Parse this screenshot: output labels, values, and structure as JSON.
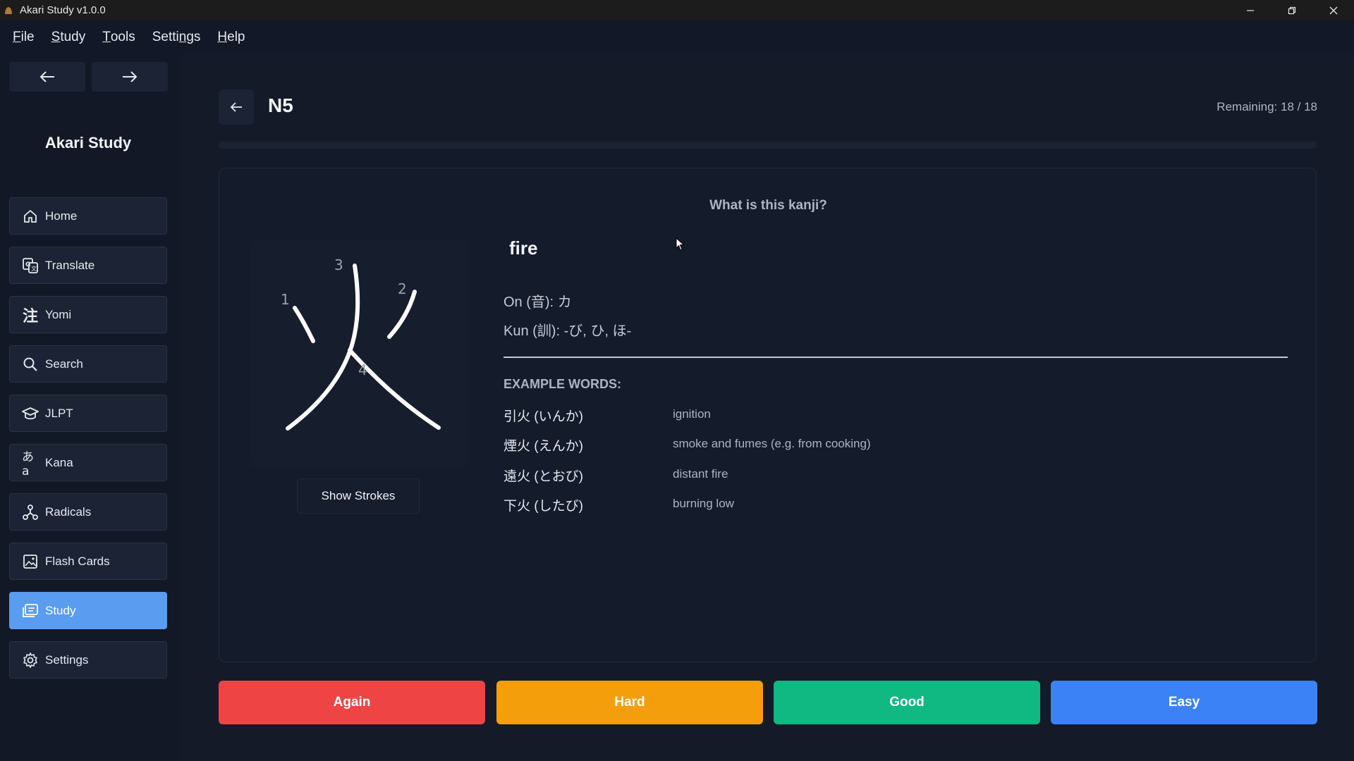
{
  "window": {
    "title": "Akari Study v1.0.0"
  },
  "menu": [
    {
      "pre": "",
      "ul": "F",
      "post": "ile"
    },
    {
      "pre": "",
      "ul": "S",
      "post": "tudy"
    },
    {
      "pre": "",
      "ul": "T",
      "post": "ools"
    },
    {
      "pre": "Setti",
      "ul": "n",
      "post": "gs"
    },
    {
      "pre": "",
      "ul": "H",
      "post": "elp"
    }
  ],
  "sidebar": {
    "brand": "Akari Study",
    "items": [
      {
        "label": "Home",
        "icon": "home-icon"
      },
      {
        "label": "Translate",
        "icon": "translate-icon"
      },
      {
        "label": "Yomi",
        "icon": "yomi-icon"
      },
      {
        "label": "Search",
        "icon": "search-icon"
      },
      {
        "label": "JLPT",
        "icon": "graduation-cap-icon"
      },
      {
        "label": "Kana",
        "icon": "kana-icon"
      },
      {
        "label": "Radicals",
        "icon": "radicals-icon"
      },
      {
        "label": "Flash Cards",
        "icon": "image-icon"
      },
      {
        "label": "Study",
        "icon": "study-icon"
      },
      {
        "label": "Settings",
        "icon": "gear-icon"
      }
    ],
    "active": "Study"
  },
  "header": {
    "level": "N5",
    "remaining": "Remaining: 18 / 18",
    "progress_fraction": 0
  },
  "card": {
    "question": "What is this kanji?",
    "kanji": "火",
    "stroke_numbers": [
      "1",
      "2",
      "3",
      "4"
    ],
    "show_strokes_label": "Show Strokes",
    "meaning": "fire",
    "on_reading": "On (音): カ",
    "kun_reading": "Kun (訓): -び, ひ, ほ-",
    "examples_title": "EXAMPLE WORDS:",
    "examples": [
      {
        "word": "引火 (いんか)",
        "meaning": "ignition"
      },
      {
        "word": "煙火 (えんか)",
        "meaning": "smoke and fumes (e.g. from cooking)"
      },
      {
        "word": "遠火 (とおび)",
        "meaning": "distant fire"
      },
      {
        "word": "下火 (したび)",
        "meaning": "burning low"
      }
    ]
  },
  "grades": [
    {
      "label": "Again",
      "color": "#ef4444"
    },
    {
      "label": "Hard",
      "color": "#f59e0b"
    },
    {
      "label": "Good",
      "color": "#10b981"
    },
    {
      "label": "Easy",
      "color": "#3b82f6"
    }
  ],
  "colors": {
    "accent": "#5a9cf0",
    "background": "#141a28"
  }
}
